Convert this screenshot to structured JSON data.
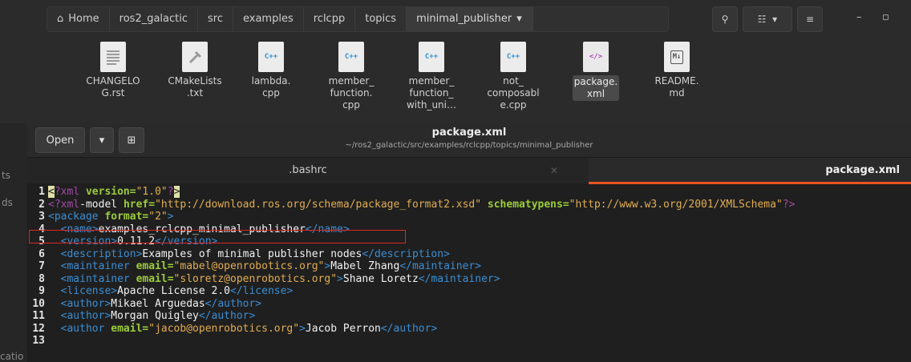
{
  "file_manager": {
    "breadcrumbs": [
      "Home",
      "ros2_galactic",
      "src",
      "examples",
      "rclcpp",
      "topics",
      "minimal_publisher"
    ],
    "active_crumb": "minimal_publisher",
    "files": [
      {
        "icon": "text-file-icon",
        "badge": "",
        "name_lines": [
          "CHANGELO",
          "G.rst"
        ]
      },
      {
        "icon": "cmake-file-icon",
        "badge": "",
        "name_lines": [
          "CMakeLists",
          ".txt"
        ]
      },
      {
        "icon": "cpp-file-icon",
        "badge": "C++",
        "name_lines": [
          "lambda.",
          "cpp"
        ]
      },
      {
        "icon": "cpp-file-icon",
        "badge": "C++",
        "name_lines": [
          "member_",
          "function.",
          "cpp"
        ]
      },
      {
        "icon": "cpp-file-icon",
        "badge": "C++",
        "name_lines": [
          "member_",
          "function_",
          "with_uni…"
        ]
      },
      {
        "icon": "cpp-file-icon",
        "badge": "C++",
        "name_lines": [
          "not_",
          "composabl",
          "e.cpp"
        ]
      },
      {
        "icon": "xml-file-icon",
        "badge": "</>",
        "name_lines": [
          "package.",
          "xml"
        ]
      },
      {
        "icon": "markdown-file-icon",
        "badge": "M↓",
        "name_lines": [
          "README.",
          "md"
        ]
      }
    ]
  },
  "left_strip": {
    "texts": [
      "ts",
      "ds",
      "catio"
    ]
  },
  "editor_window": {
    "open_label": "Open",
    "title": "package.xml",
    "path": "~/ros2_galactic/src/examples/rclcpp/topics/minimal_publisher",
    "tabs": [
      {
        "label": ".bashrc",
        "active": false
      },
      {
        "label": "package.xml",
        "active": true
      }
    ],
    "accent_color": "#e95420"
  },
  "code_lines": [
    {
      "n": "1",
      "segments": [
        [
          "hl",
          "<"
        ],
        [
          "pi",
          "?xml "
        ],
        [
          "attr",
          "version="
        ],
        [
          "val",
          "\"1.0\""
        ],
        [
          "pi",
          "?"
        ],
        [
          "hl",
          ">"
        ]
      ]
    },
    {
      "n": "2",
      "segments": [
        [
          "pi",
          "<?xml"
        ],
        [
          "txt",
          "-model "
        ],
        [
          "attr",
          "href="
        ],
        [
          "val",
          "\"http://download.ros.org/schema/package_format2.xsd\" "
        ],
        [
          "attr",
          "schematypens="
        ],
        [
          "val",
          "\"http://www.w3.org/2001/XMLSchema\""
        ],
        [
          "pi",
          "?>"
        ]
      ]
    },
    {
      "n": "3",
      "segments": [
        [
          "tag",
          "<package "
        ],
        [
          "attr",
          "format="
        ],
        [
          "val",
          "\"2\""
        ],
        [
          "tag",
          ">"
        ]
      ]
    },
    {
      "n": "4",
      "segments": [
        [
          "txt",
          "  "
        ],
        [
          "tag",
          "<name>"
        ],
        [
          "txt",
          "examples_rclcpp_minimal_publisher"
        ],
        [
          "tag",
          "</name>"
        ]
      ]
    },
    {
      "n": "5",
      "segments": [
        [
          "txt",
          "  "
        ],
        [
          "tag",
          "<version>"
        ],
        [
          "txt",
          "0.11.2"
        ],
        [
          "tag",
          "</version>"
        ]
      ]
    },
    {
      "n": "6",
      "segments": [
        [
          "txt",
          "  "
        ],
        [
          "tag",
          "<description>"
        ],
        [
          "txt",
          "Examples of minimal publisher nodes"
        ],
        [
          "tag",
          "</description>"
        ]
      ]
    },
    {
      "n": "7",
      "segments": [
        [
          "txt",
          "  "
        ],
        [
          "tag",
          "<maintainer "
        ],
        [
          "attr",
          "email="
        ],
        [
          "val",
          "\"mabel@openrobotics.org\""
        ],
        [
          "tag",
          ">"
        ],
        [
          "txt",
          "Mabel Zhang"
        ],
        [
          "tag",
          "</maintainer>"
        ]
      ]
    },
    {
      "n": "8",
      "segments": [
        [
          "txt",
          "  "
        ],
        [
          "tag",
          "<maintainer "
        ],
        [
          "attr",
          "email="
        ],
        [
          "val",
          "\"sloretz@openrobotics.org\""
        ],
        [
          "tag",
          ">"
        ],
        [
          "txt",
          "Shane Loretz"
        ],
        [
          "tag",
          "</maintainer>"
        ]
      ]
    },
    {
      "n": "9",
      "segments": [
        [
          "txt",
          "  "
        ],
        [
          "tag",
          "<license>"
        ],
        [
          "txt",
          "Apache License 2.0"
        ],
        [
          "tag",
          "</license>"
        ]
      ]
    },
    {
      "n": "10",
      "segments": [
        [
          "txt",
          "  "
        ],
        [
          "tag",
          "<author>"
        ],
        [
          "txt",
          "Mikael Arguedas"
        ],
        [
          "tag",
          "</author>"
        ]
      ]
    },
    {
      "n": "11",
      "segments": [
        [
          "txt",
          "  "
        ],
        [
          "tag",
          "<author>"
        ],
        [
          "txt",
          "Morgan Quigley"
        ],
        [
          "tag",
          "</author>"
        ]
      ]
    },
    {
      "n": "12",
      "segments": [
        [
          "txt",
          "  "
        ],
        [
          "tag",
          "<author "
        ],
        [
          "attr",
          "email="
        ],
        [
          "val",
          "\"jacob@openrobotics.org\""
        ],
        [
          "tag",
          ">"
        ],
        [
          "txt",
          "Jacob Perron"
        ],
        [
          "tag",
          "</author>"
        ]
      ]
    },
    {
      "n": "13",
      "segments": []
    }
  ]
}
